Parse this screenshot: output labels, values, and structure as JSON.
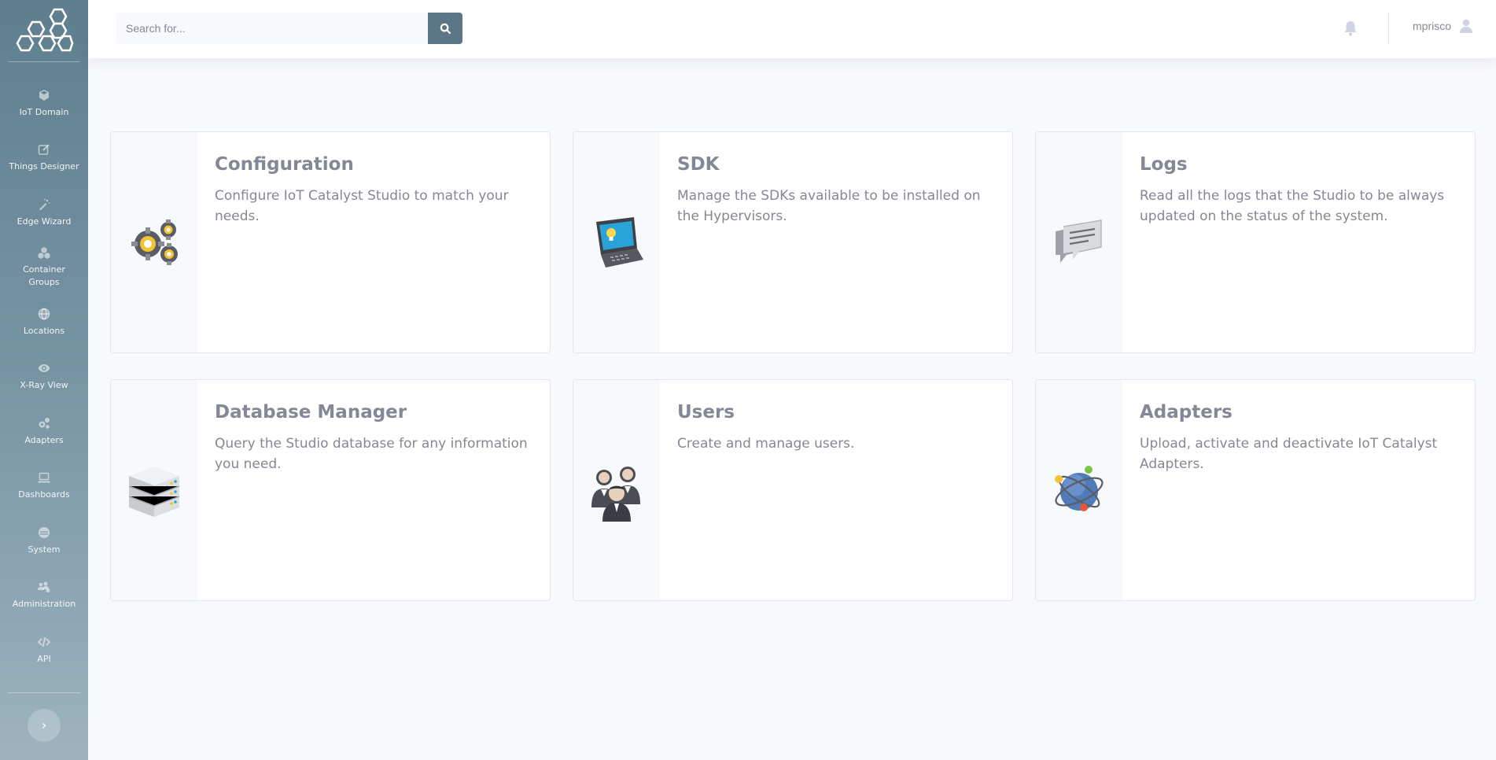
{
  "brand": {
    "logo_icon": "hexagons-logo-icon"
  },
  "sidebar": {
    "items": [
      {
        "label": "IoT Domain",
        "icon": "cube-icon"
      },
      {
        "label": "Things Designer",
        "icon": "edit-icon"
      },
      {
        "label": "Edge Wizard",
        "icon": "magic-wand-icon"
      },
      {
        "label": "Container Groups",
        "icon": "cubes-icon"
      },
      {
        "label": "Locations",
        "icon": "globe-icon"
      },
      {
        "label": "X-Ray View",
        "icon": "eye-icon"
      },
      {
        "label": "Adapters",
        "icon": "cogs-icon"
      },
      {
        "label": "Dashboards",
        "icon": "laptop-icon"
      },
      {
        "label": "System",
        "icon": "database-icon"
      },
      {
        "label": "Administration",
        "icon": "users-cog-icon"
      },
      {
        "label": "API",
        "icon": "code-icon"
      }
    ],
    "toggle_label": "›"
  },
  "topbar": {
    "search": {
      "placeholder": "Search for...",
      "value": ""
    },
    "username": "mprisco"
  },
  "cards": [
    {
      "title": "Configuration",
      "description": "Configure IoT Catalyst Studio to match your needs.",
      "icon": "gears-icon"
    },
    {
      "title": "SDK",
      "description": "Manage the SDKs available to be installed on the Hypervisors.",
      "icon": "laptop-bulb-icon"
    },
    {
      "title": "Logs",
      "description": "Read all the logs that the Studio to be always updated on the status of the system.",
      "icon": "chat-bubbles-icon"
    },
    {
      "title": "Database Manager",
      "description": "Query the Studio database for any information you need.",
      "icon": "server-rack-icon"
    },
    {
      "title": "Users",
      "description": "Create and manage users.",
      "icon": "users-group-icon"
    },
    {
      "title": "Adapters",
      "description": "Upload, activate and deactivate IoT Catalyst Adapters.",
      "icon": "globe-network-icon"
    }
  ],
  "colors": {
    "sidebar_top": "#5f7e8e",
    "sidebar_bottom": "#9db3bf",
    "search_button": "#5b7686",
    "text_muted": "#858796",
    "background": "#f8f9fc"
  }
}
